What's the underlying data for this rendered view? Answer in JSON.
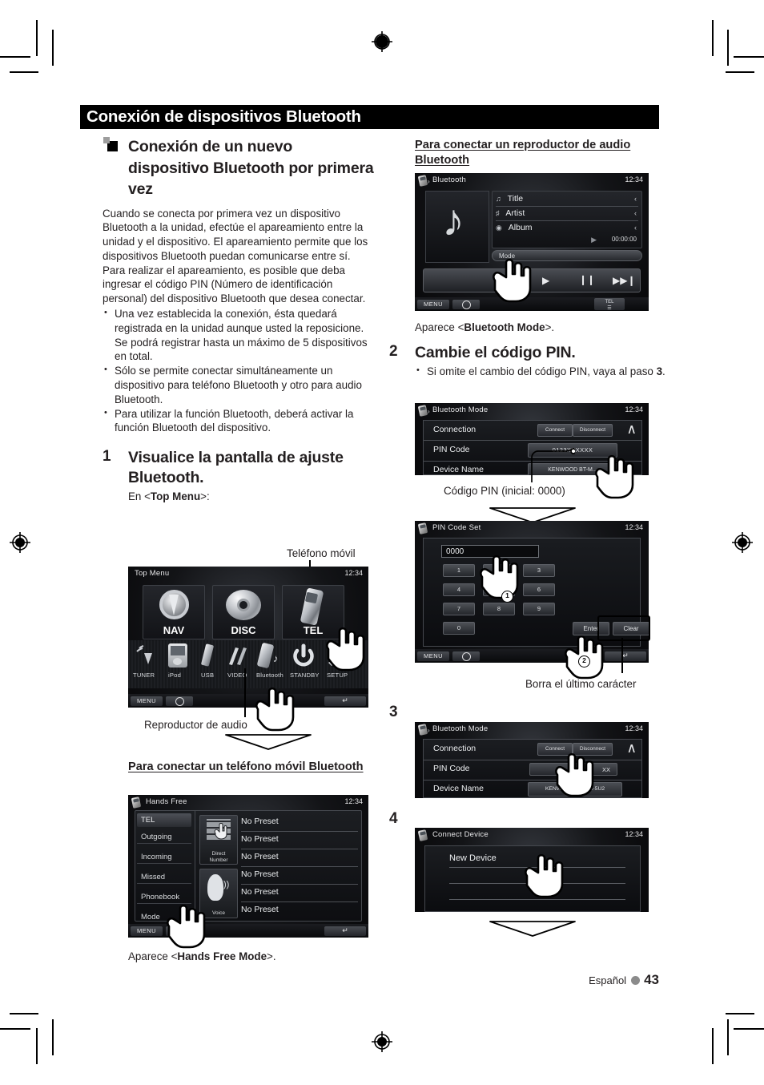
{
  "banner": {
    "title": "Conexión de dispositivos Bluetooth"
  },
  "left": {
    "section_heading": "Conexión de un nuevo dispositivo Bluetooth por primera vez",
    "intro": "Cuando se conecta por primera vez un dispositivo Bluetooth a la unidad, efectúe el apareamiento entre la unidad y el dispositivo. El apareamiento permite que los dispositivos Bluetooth puedan comunicarse entre sí. Para realizar el apareamiento, es posible que deba ingresar el código PIN (Número de identificación personal) del dispositivo Bluetooth que desea conectar.",
    "bullets": [
      "Una vez establecida la conexión, ésta quedará registrada en la unidad aunque usted la reposicione. Se podrá registrar hasta un máximo de 5 dispositivos en total.",
      "Sólo se permite conectar simultáneamente un dispositivo para teléfono Bluetooth y otro para audio Bluetooth.",
      "Para utilizar la función Bluetooth, deberá activar la función Bluetooth del dispositivo."
    ],
    "step1": {
      "number": "1",
      "text": "Visualice la pantalla de ajuste Bluetooth.",
      "sub_prefix": "En <",
      "sub_bold": "Top Menu",
      "sub_suffix": ">:"
    },
    "callout_phone": "Teléfono móvil",
    "callout_audio": "Reproductor de audio",
    "subheading_phone": "Para conectar un teléfono móvil Bluetooth",
    "caption_handsfree_prefix": "Aparece <",
    "caption_handsfree_bold": "Hands Free Mode",
    "caption_handsfree_suffix": ">."
  },
  "right": {
    "subheading_audio": "Para conectar un reproductor de audio Bluetooth",
    "caption_btmode_prefix": "Aparece <",
    "caption_btmode_bold": "Bluetooth Mode",
    "caption_btmode_suffix": ">.",
    "step2": {
      "number": "2",
      "text": "Cambie el código PIN.",
      "bullet_pre": "Si omite el cambio del código PIN, vaya al paso ",
      "bullet_bold": "3",
      "bullet_post": "."
    },
    "callout_pin": "Código PIN (inicial: 0000)",
    "callout_clear": "Borra el último carácter",
    "step3": {
      "number": "3"
    },
    "step4": {
      "number": "4"
    }
  },
  "screens": {
    "topmenu": {
      "title": "Top Menu",
      "clock": "12:34",
      "tiles": [
        {
          "label": "NAV"
        },
        {
          "label": "DISC"
        },
        {
          "label": "TEL"
        }
      ],
      "shortcuts": [
        "TUNER",
        "iPod",
        "USB",
        "VIDEO",
        "Bluetooth",
        "STANDBY",
        "SETUP"
      ],
      "menu_label": "MENU"
    },
    "handsfree": {
      "title": "Hands Free",
      "clock": "12:34",
      "side_items": [
        "TEL",
        "Outgoing",
        "Incoming",
        "Missed",
        "Phonebook",
        "Mode"
      ],
      "pad_labels": [
        "Direct Number",
        "Voice"
      ],
      "presets": [
        "No Preset",
        "No Preset",
        "No Preset",
        "No Preset",
        "No Preset",
        "No Preset"
      ],
      "menu_label": "MENU"
    },
    "btaudio": {
      "title": "Bluetooth",
      "clock": "12:34",
      "rows": [
        "Title",
        "Artist",
        "Album"
      ],
      "time": "00:00:00",
      "mode_label": "Mode",
      "transport": [
        "play",
        "pause",
        "next"
      ],
      "menu_label": "MENU",
      "tel_badge": "TEL"
    },
    "btmode2": {
      "title": "Bluetooth Mode",
      "clock": "12:34",
      "rows": [
        {
          "label": "Connection",
          "buttons": [
            "Connect",
            "Disconnect"
          ]
        },
        {
          "label": "PIN Code",
          "value": "0123XXXXXX"
        },
        {
          "label": "Device Name",
          "value": "KENWOOD BT-M..."
        }
      ]
    },
    "pinset": {
      "title": "PIN Code Set",
      "clock": "12:34",
      "value": "0000",
      "keys": [
        "1",
        "2",
        "3",
        "4",
        "5",
        "6",
        "7",
        "8",
        "9",
        "0"
      ],
      "enter_label": "Enter",
      "clear_label": "Clear",
      "menu_label": "MENU"
    },
    "btmode3": {
      "title": "Bluetooth Mode",
      "clock": "12:34",
      "rows": [
        {
          "label": "Connection",
          "buttons": [
            "Connect",
            "Disconnect"
          ]
        },
        {
          "label": "PIN Code",
          "value": "XX"
        },
        {
          "label": "Device Name",
          "value": "KENWOOD BT MM-5U2"
        }
      ]
    },
    "connectdev": {
      "title": "Connect Device",
      "clock": "12:34",
      "items": [
        "New Device",
        "",
        "",
        ""
      ]
    }
  },
  "footer": {
    "language": "Español",
    "page": "43"
  },
  "colors": {
    "banner_bg": "#000000",
    "text": "#231f20",
    "dot": "#8b8b8b"
  }
}
